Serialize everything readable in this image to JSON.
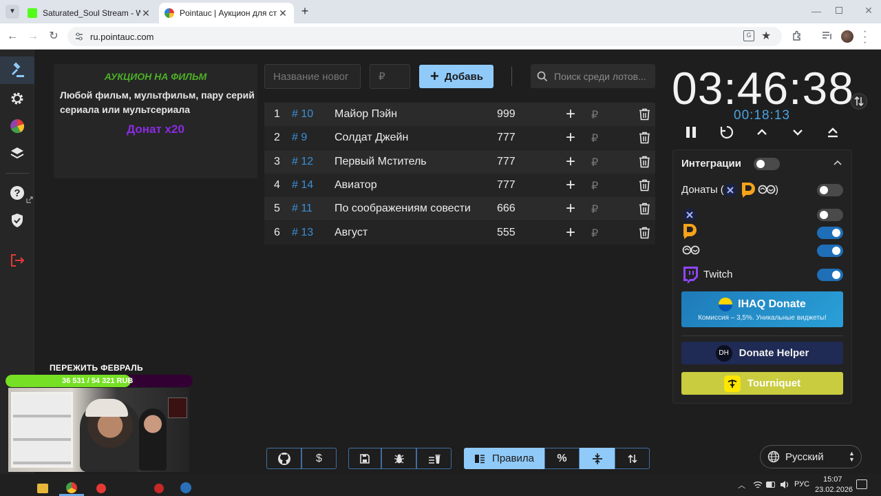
{
  "browser": {
    "tabs": [
      {
        "title": "Saturated_Soul Stream - Watch"
      },
      {
        "title": "Pointauc | Аукцион для стриме"
      }
    ],
    "url": "ru.pointauc.com"
  },
  "rules": {
    "title": "АУКЦИОН НА ФИЛЬМ",
    "line1": "Любой фильм, мультфильм, пару серий",
    "line2": "сериала или мультсериала",
    "donate": "Донат x20"
  },
  "form": {
    "name_placeholder": "Название новог",
    "amount_placeholder": "₽",
    "add_label": "Добавь",
    "search_placeholder": "Поиск среди лотов..."
  },
  "lots": [
    {
      "num": "1",
      "id": "# 10",
      "name": "Майор Пэйн",
      "amount": "999"
    },
    {
      "num": "2",
      "id": "# 9",
      "name": "Солдат Джейн",
      "amount": "777"
    },
    {
      "num": "3",
      "id": "# 12",
      "name": "Первый Мститель",
      "amount": "777"
    },
    {
      "num": "4",
      "id": "# 14",
      "name": "Авиатор",
      "amount": "777"
    },
    {
      "num": "5",
      "id": "# 11",
      "name": "По соображениям совести",
      "amount": "666"
    },
    {
      "num": "6",
      "id": "# 13",
      "name": "Август",
      "amount": "555"
    }
  ],
  "lot_symbols": {
    "plus": "+",
    "currency": "₽"
  },
  "timer": {
    "main": "03:46:38",
    "sub": "00:18:13"
  },
  "integrations": {
    "title": "Интеграции",
    "donations_label": "Донаты (",
    "donations_close": ")",
    "twitch_label": "Twitch",
    "toggles": {
      "main": false,
      "donations": false,
      "x": false,
      "da": true,
      "infinity": true,
      "twitch": true
    },
    "ihaq": {
      "title": "IHAQ Donate",
      "subtitle": "Комиссия – 3,5%. Уникальные виджеты!"
    },
    "donate_helper": {
      "logo": "DH",
      "label": "Donate Helper"
    },
    "tourniquet": {
      "label": "Tourniquet"
    }
  },
  "toolbar": {
    "dollar": "$",
    "rules_label": "Правила",
    "percent": "%"
  },
  "language": {
    "label": "Русский"
  },
  "stream_overlay": {
    "goal_title": "ПЕРЕЖИТЬ ФЕВРАЛЬ",
    "goal_progress": "36 531 / 54 321 RUB",
    "goal_fraction": 0.67
  },
  "taskbar": {
    "lang": "РУС",
    "time": "15:07",
    "date": "23.02.2026"
  },
  "colors": {
    "accent": "#90caf9",
    "green": "#4caf27",
    "purple": "#8a2be2",
    "id_blue": "#3b8fd8"
  }
}
